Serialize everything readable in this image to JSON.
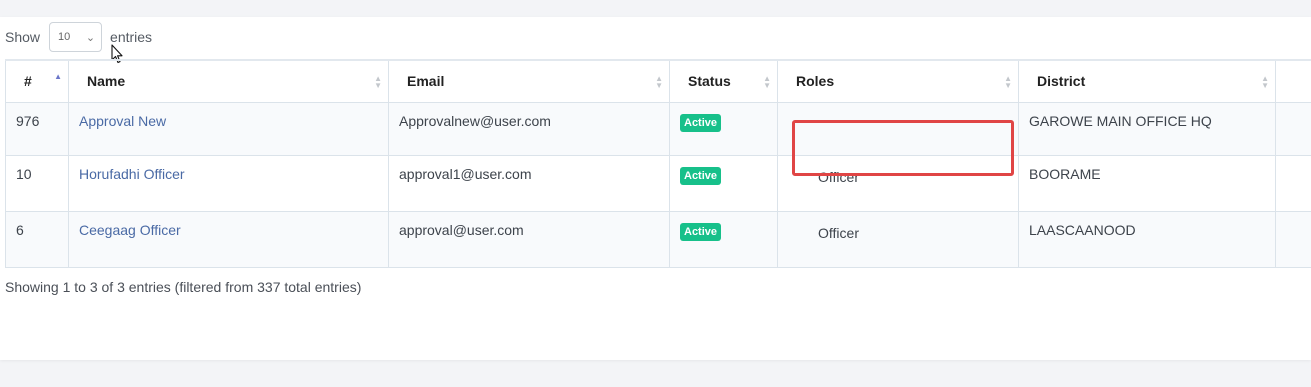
{
  "length_menu": {
    "show_label": "Show",
    "selected_value": "10",
    "entries_label": "entries"
  },
  "table": {
    "columns": [
      {
        "key": "num",
        "label": "#"
      },
      {
        "key": "name",
        "label": "Name"
      },
      {
        "key": "email",
        "label": "Email"
      },
      {
        "key": "status",
        "label": "Status"
      },
      {
        "key": "roles",
        "label": "Roles"
      },
      {
        "key": "district",
        "label": "District"
      }
    ],
    "rows": [
      {
        "num": "976",
        "name": "Approval New",
        "email": "Approvalnew@user.com",
        "status": "Active",
        "roles": "",
        "district": "GAROWE MAIN OFFICE HQ"
      },
      {
        "num": "10",
        "name": "Horufadhi Officer",
        "email": "approval1@user.com",
        "status": "Active",
        "roles": "Officer",
        "district": "BOORAME"
      },
      {
        "num": "6",
        "name": "Ceegaag Officer",
        "email": "approval@user.com",
        "status": "Active",
        "roles": "Officer",
        "district": "LAASCAANOOD"
      }
    ]
  },
  "info_text": "Showing 1 to 3 of 3 entries (filtered from 337 total entries)",
  "colors": {
    "status_active": "#17c08a",
    "link": "#4a6aa5",
    "highlight_box": "#e04545",
    "sort_active": "#6b76c9"
  },
  "icons": {
    "dropdown": "chevron-down-icon",
    "sort": "sort-icon",
    "cursor": "mouse-pointer-icon"
  }
}
